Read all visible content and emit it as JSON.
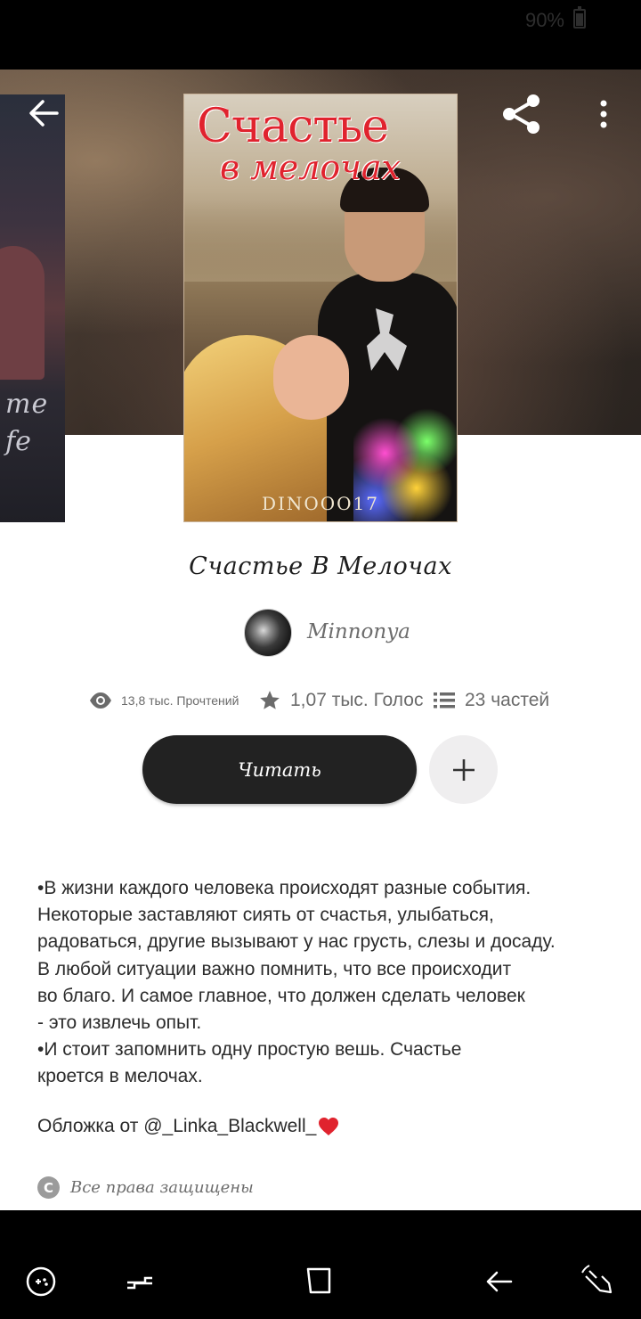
{
  "status": {
    "battery": "90%"
  },
  "book": {
    "title": "Счастье В Мелочах",
    "author": "Minnonya",
    "cover_title_line1": "Счастье",
    "cover_title_line2": "в мелочах",
    "cover_author": "DINOOO17",
    "side_cover_words": [
      "me",
      "fe"
    ]
  },
  "stats": {
    "reads": "13,8 тыс. Прочтений",
    "votes": "1,07 тыс. Голос",
    "parts": "23 частей"
  },
  "actions": {
    "read_label": "Читать",
    "add_label": "+"
  },
  "description": [
    "•В жизни каждого человека происходят разные события.",
    "Некоторые заставляют сиять от счастья, улыбаться,",
    "радоваться, другие вызывают у нас грусть, слезы и досаду.",
    "В любой ситуации важно помнить, что все происходит",
    "во благо. И самое главное, что должен сделать человек",
    "- это извлечь опыт.",
    "•И стоит запомнить одну простую вешь. Счастье",
    "кроется в мелочах."
  ],
  "cover_credit": "Обложка от @_Linka_Blackwell_",
  "copyright": "Все права защищены",
  "icons": {
    "back": "arrow-left",
    "share": "share",
    "more": "vertical-ellipsis",
    "reads": "eye",
    "votes": "star",
    "parts": "list",
    "add": "plus",
    "heart": "heart",
    "copyright": "copyright-c"
  },
  "colors": {
    "button_dark": "#222222",
    "heart": "#e0232e"
  }
}
